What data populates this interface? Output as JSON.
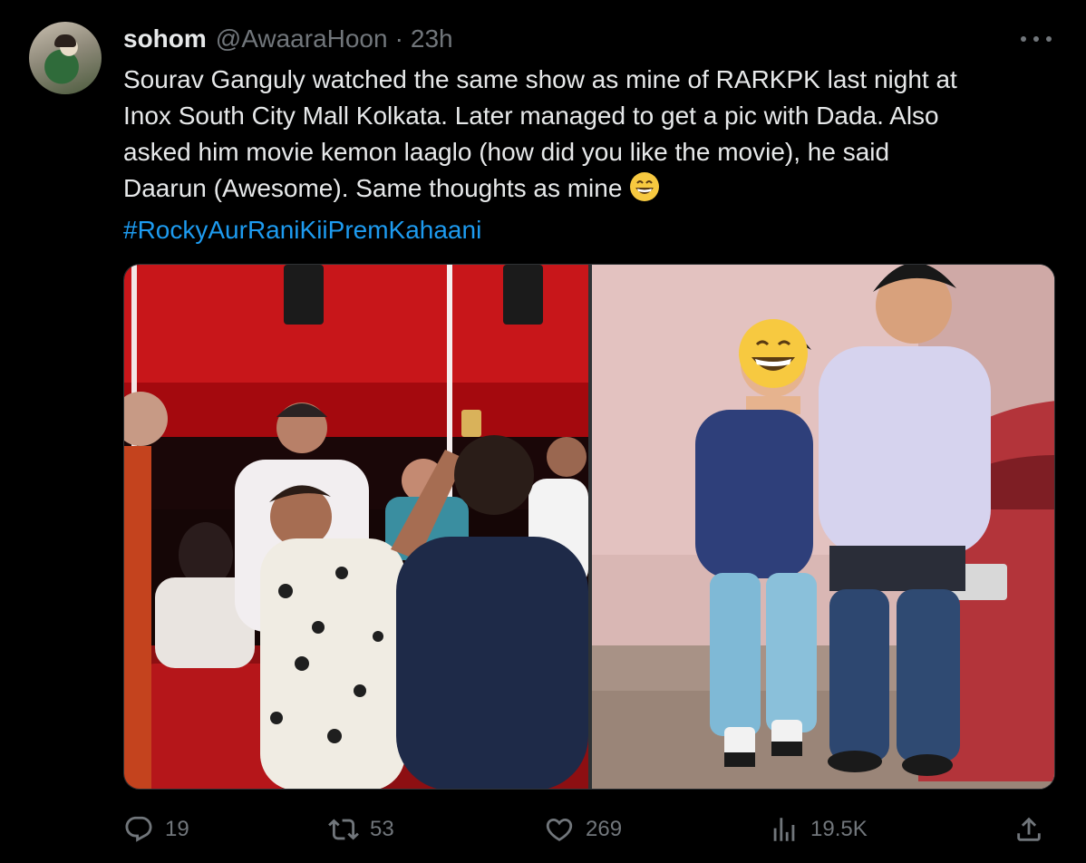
{
  "user": {
    "name": "sohom",
    "handle": "@AwaaraHoon",
    "separator": "·",
    "time": "23h"
  },
  "tweet": {
    "lines": [
      "Sourav Ganguly watched the same show as mine of RARKPK last night at",
      "Inox South City Mall Kolkata. Later managed to get a pic with Dada. Also",
      "asked him movie kemon laaglo (how did you like the movie), he said",
      "Daarun (Awesome). Same thoughts as mine"
    ],
    "emoji": "grinning-face-emoji",
    "hashtag": "#RockyAurRaniKiiPremKahaani"
  },
  "media": {
    "left_photo": "theatre crowd selfie",
    "right_photo": "two men posing by red car"
  },
  "actions": {
    "replies": "19",
    "retweets": "53",
    "likes": "269",
    "views": "19.5K"
  },
  "icons": [
    "more-icon",
    "reply-icon",
    "retweet-icon",
    "like-icon",
    "views-icon",
    "share-icon"
  ],
  "colors": {
    "background": "#000000",
    "text": "#e7e9ea",
    "muted": "#71767b",
    "link": "#1d9bf0"
  }
}
